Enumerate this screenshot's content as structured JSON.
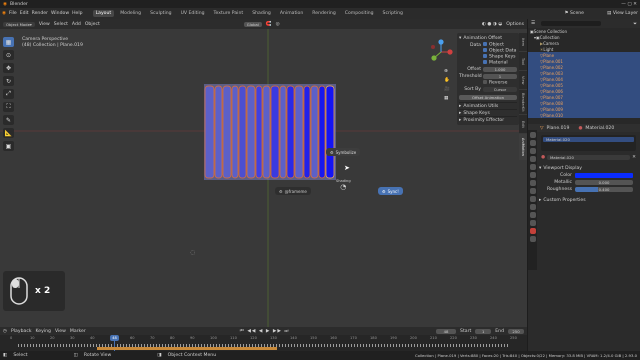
{
  "titlebar": {
    "title": "Blender"
  },
  "menubar": {
    "menus": [
      "File",
      "Edit",
      "Render",
      "Window",
      "Help"
    ],
    "workspaces": [
      "Layout",
      "Modeling",
      "Sculpting",
      "UV Editing",
      "Texture Paint",
      "Shading",
      "Animation",
      "Rendering",
      "Compositing",
      "Scripting"
    ],
    "scene_label": "Scene",
    "view_layer_label": "View Layer"
  },
  "viewport_header": {
    "mode": "Object Mode",
    "menus": [
      "View",
      "Select",
      "Add",
      "Object"
    ],
    "transform": "Global",
    "options": "Options"
  },
  "viewport": {
    "camera_label": "Camera Perspective",
    "collection_label": "(48) Collection | Plane.019",
    "gizmo": {
      "x": "X",
      "y": "Y",
      "z": "Z"
    },
    "popups": {
      "hover_label": "Symbolize",
      "left_label": "@frameme",
      "right_label": "Sync!",
      "mid_label": "Shading"
    }
  },
  "npanel": {
    "section": "Animation Offset",
    "data_label": "Data",
    "checks": [
      "Object",
      "Object Data",
      "Shape Keys",
      "Material"
    ],
    "offset_label": "Offset",
    "offset_value": "1.000",
    "threshold_label": "Threshold",
    "threshold_value": "1",
    "reverse_label": "Reverse",
    "sort_label": "Sort By",
    "sort_value": "Cursor",
    "apply_button": "Offset Animation",
    "subpanels": [
      "Animation Utils",
      "Shape Keys",
      "Proximity Effector"
    ],
    "tabs": [
      "Item",
      "Tool",
      "View",
      "BlenderKit",
      "Edit",
      "AniMotion"
    ]
  },
  "outliner": {
    "root": "Scene Collection",
    "items": [
      {
        "name": "Collection",
        "selected": false
      },
      {
        "name": "Camera",
        "selected": false
      },
      {
        "name": "Light",
        "selected": false
      },
      {
        "name": "Plane",
        "selected": true
      },
      {
        "name": "Plane.001",
        "selected": true
      },
      {
        "name": "Plane.002",
        "selected": true
      },
      {
        "name": "Plane.003",
        "selected": true
      },
      {
        "name": "Plane.004",
        "selected": true
      },
      {
        "name": "Plane.005",
        "selected": true
      },
      {
        "name": "Plane.006",
        "selected": true
      },
      {
        "name": "Plane.007",
        "selected": true
      },
      {
        "name": "Plane.008",
        "selected": true
      },
      {
        "name": "Plane.009",
        "selected": true
      },
      {
        "name": "Plane.010",
        "selected": true
      }
    ]
  },
  "properties": {
    "object_name": "Plane.019",
    "material_name": "Material.020",
    "slot": "Material.020",
    "mat_field": "Material.020",
    "viewport_display": "Viewport Display",
    "color_label": "Color",
    "color_value": "#0a2cff",
    "metallic_label": "Metallic",
    "metallic_value": "0.000",
    "roughness_label": "Roughness",
    "roughness_value": "0.400",
    "custom_props": "Custom Properties"
  },
  "timeline": {
    "menus": [
      "Playback",
      "Keying",
      "View",
      "Marker"
    ],
    "current_frame": "48",
    "start_label": "Start",
    "start_value": "1",
    "end_label": "End",
    "end_value": "250",
    "ticks": [
      "0",
      "10",
      "20",
      "30",
      "40",
      "50",
      "60",
      "70",
      "80",
      "90",
      "100",
      "110",
      "120",
      "130",
      "140",
      "150",
      "160",
      "170",
      "180",
      "190",
      "200",
      "210",
      "220",
      "230",
      "240",
      "250"
    ]
  },
  "statusbar": {
    "left": [
      "Select",
      "Rotate View",
      "Object Context Menu"
    ],
    "right": "Collection | Plane.019 | Verts:880 | Faces:20 | Tris:840 | Objects:0/22 | Memory: 33.8 MiB | VRAM: 1.2/4.0 GiB | 2.93.0"
  },
  "overlay": {
    "mouse_badge": "x 2"
  }
}
